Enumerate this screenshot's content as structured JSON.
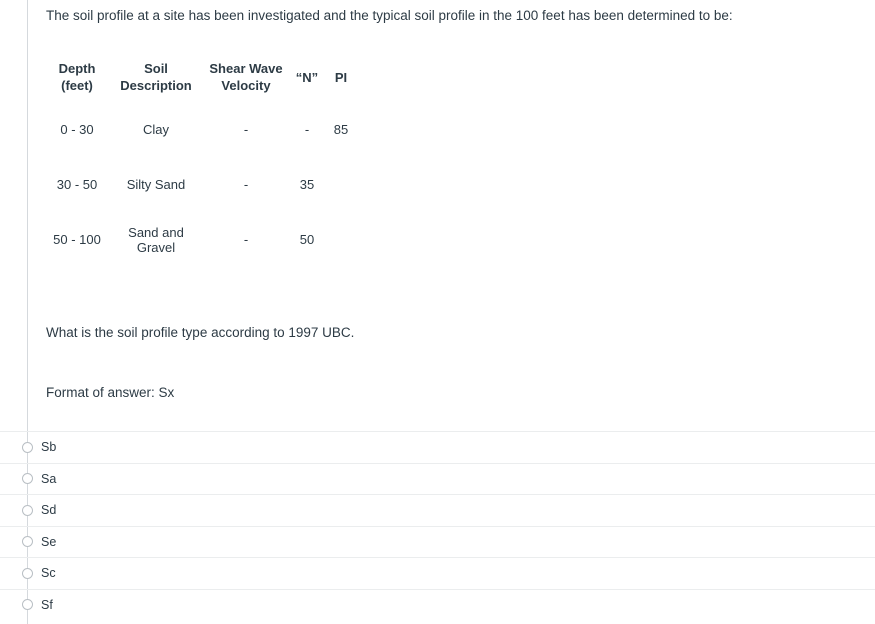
{
  "intro": {
    "text": "The soil profile at a site has been investigated and the typical soil profile in the 100 feet has been determined to be:"
  },
  "table": {
    "headers": {
      "depth_line1": "Depth",
      "depth_line2": "(feet)",
      "description": "Soil Description",
      "shear_line1": "Shear Wave",
      "shear_line2": "Velocity",
      "n_value": "“N”",
      "pi": "PI"
    },
    "rows": [
      {
        "depth": "0 - 30",
        "description": "Clay",
        "shear_wave_velocity": "-",
        "n_value": "-",
        "pi": "85"
      },
      {
        "depth": "30 - 50",
        "description": "Silty Sand",
        "shear_wave_velocity": "-",
        "n_value": "35",
        "pi": ""
      },
      {
        "depth": "50 - 100",
        "description": "Sand and Gravel",
        "shear_wave_velocity": "-",
        "n_value": "50",
        "pi": ""
      }
    ]
  },
  "question": {
    "text": "What is the soil profile type according to 1997 UBC."
  },
  "format_hint": {
    "text": "Format of answer: Sx"
  },
  "answers": {
    "options": [
      {
        "label": "Sb",
        "selected": false
      },
      {
        "label": "Sa",
        "selected": false
      },
      {
        "label": "Sd",
        "selected": false
      },
      {
        "label": "Se",
        "selected": false
      },
      {
        "label": "Sc",
        "selected": false
      },
      {
        "label": "Sf",
        "selected": false
      }
    ]
  },
  "colors": {
    "text": "#2d3b45",
    "divider": "#ebedee",
    "left_rule": "#d5d9dd",
    "radio_border": "#b9bfc4",
    "background": "#ffffff"
  }
}
